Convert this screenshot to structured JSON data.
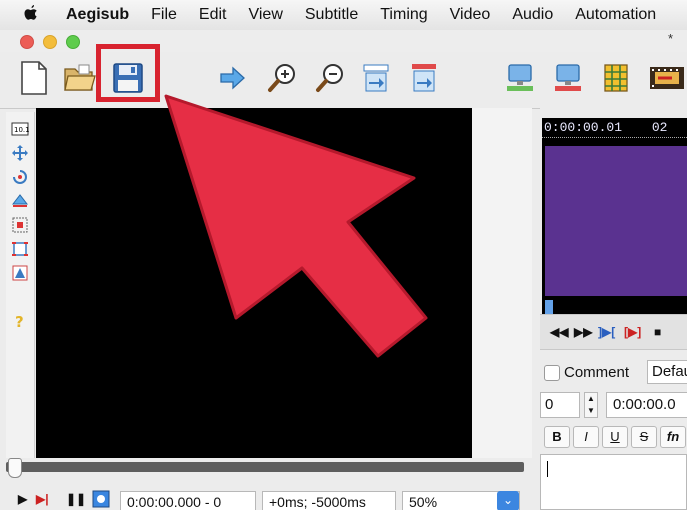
{
  "menubar": {
    "app_name": "Aegisub",
    "items": [
      "File",
      "Edit",
      "View",
      "Subtitle",
      "Timing",
      "Video",
      "Audio",
      "Automation"
    ]
  },
  "window": {
    "title_mark": "*"
  },
  "toolbar": {
    "buttons": [
      {
        "name": "new-file-icon"
      },
      {
        "name": "open-folder-icon"
      },
      {
        "name": "save-icon",
        "highlighted": true
      },
      {
        "name": "jump-to-icon"
      },
      {
        "name": "zoom-in-icon"
      },
      {
        "name": "zoom-out-icon"
      },
      {
        "name": "snap-start-icon"
      },
      {
        "name": "snap-end-icon"
      },
      {
        "name": "video-monitor-icon"
      },
      {
        "name": "video-monitor-red-icon"
      },
      {
        "name": "grid-icon"
      },
      {
        "name": "film-strip-icon"
      }
    ],
    "highlight_color": "#d8232f"
  },
  "video": {
    "time": "0:00:00.000 - 0",
    "offset": "+0ms; -5000ms",
    "zoom": "50%"
  },
  "audio": {
    "time_label": "0:00:00.01",
    "time_label_2": "02"
  },
  "edit": {
    "comment_label": "Comment",
    "style_value": "Default",
    "layer_value": "0",
    "start_time": "0:00:00.0",
    "format_buttons": [
      "B",
      "I",
      "U",
      "S",
      "fn"
    ]
  },
  "overlay": {
    "arrow_color": "#e62e45"
  }
}
